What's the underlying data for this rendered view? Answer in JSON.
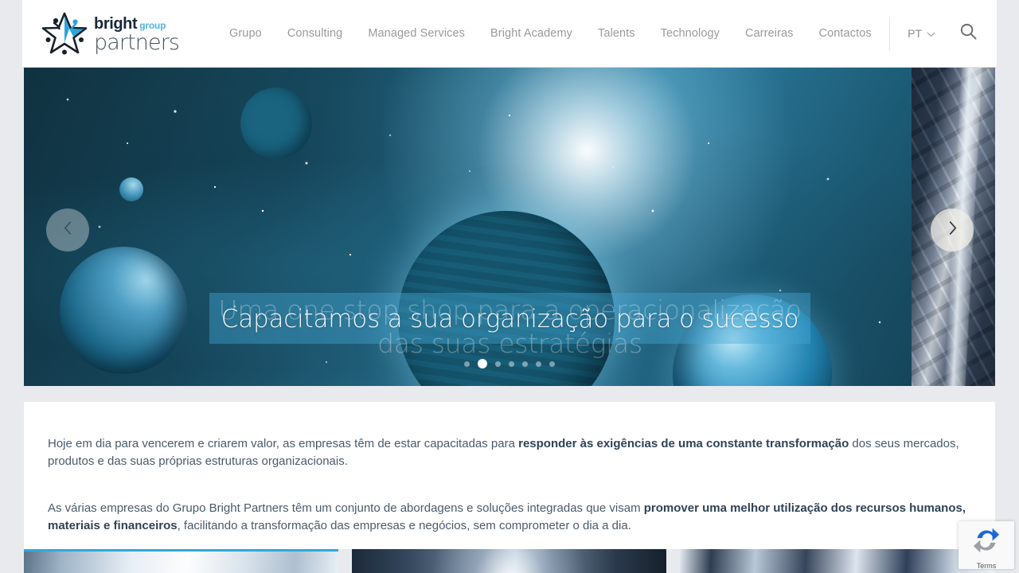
{
  "site": {
    "logo": {
      "word1": "bright",
      "group": "group",
      "word2": "partners",
      "mark": "star-people-logo"
    }
  },
  "header": {
    "nav": [
      {
        "label": "Grupo"
      },
      {
        "label": "Consulting"
      },
      {
        "label": "Managed Services"
      },
      {
        "label": "Bright Academy"
      },
      {
        "label": "Talents"
      },
      {
        "label": "Technology"
      },
      {
        "label": "Carreiras"
      },
      {
        "label": "Contactos"
      }
    ],
    "language": {
      "label": "PT",
      "icon": "chevron-down-icon"
    },
    "search": {
      "icon": "search-icon",
      "label": "Search"
    }
  },
  "hero": {
    "active_slide_index": 1,
    "slide_count": 7,
    "caption_active": "Capacitamos a sua organização para o sucesso",
    "caption_outgoing": "Uma one stop shop para a operacionalização das suas estratégias",
    "prev_label": "‹",
    "next_label": "›",
    "dots": [
      "1",
      "2",
      "3",
      "4",
      "5",
      "6",
      "7"
    ],
    "accent_band_color": "#46a6d4"
  },
  "intro": {
    "p1_a": "Hoje em dia para vencerem e criarem valor, as empresas têm de estar capacitadas para ",
    "p1_b": "responder às exigências de uma constante transformação",
    "p1_c": " dos seus mercados, produtos e das suas próprias estruturas organizacionais.",
    "p2_a": "As várias empresas do Grupo Bright Partners têm um conjunto de abordagens e soluções integradas que visam ",
    "p2_b": "promover uma melhor utilização dos recursos humanos, materiais e financeiros",
    "p2_c": ", facilitando a transformação das empresas e negócios, sem comprometer o dia a dia."
  },
  "cards": [
    {
      "name": "card-people",
      "image": "people-meeting-image",
      "active": true
    },
    {
      "name": "card-gears",
      "image": "gears-technology-image",
      "active": false
    },
    {
      "name": "card-suits",
      "image": "business-suits-image",
      "active": false
    }
  ],
  "recaptcha": {
    "terms_label": "Terms",
    "icon": "recaptcha-icon"
  },
  "colors": {
    "accent": "#2fa8e0",
    "logo_blue": "#4eb3e4",
    "nav_text": "#9b9a99",
    "body_text": "#4b5b6b",
    "page_bg": "#e8eaee"
  }
}
